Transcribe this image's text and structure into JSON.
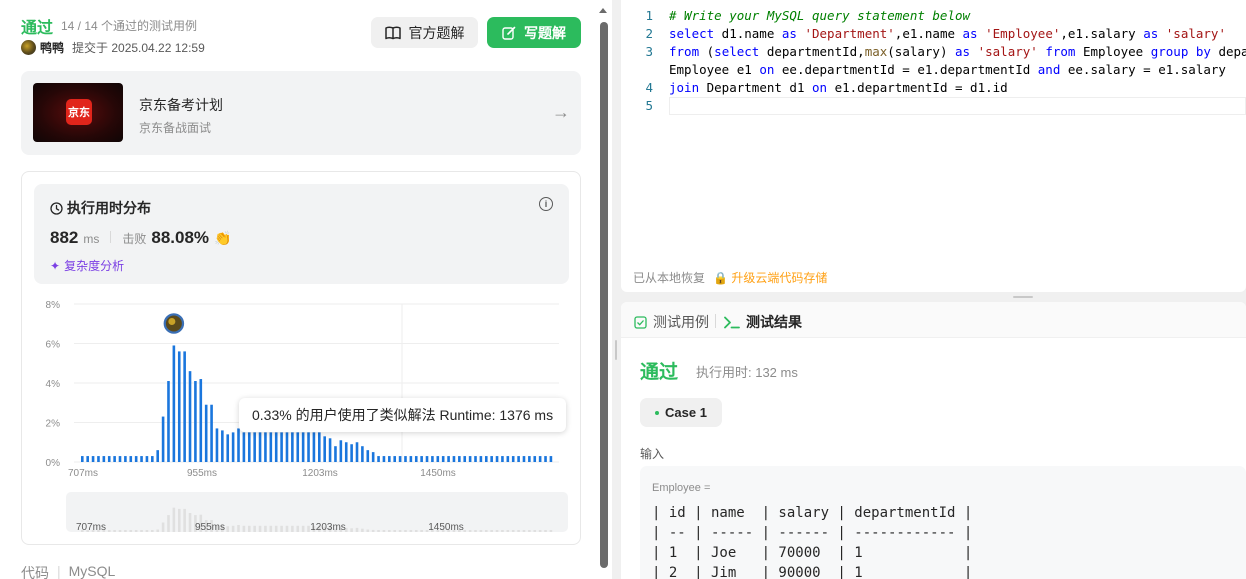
{
  "submission": {
    "status": "通过",
    "testcases": "14 / 14 个通过的测试用例",
    "user": "鸭鸭",
    "submitted_at": "提交于 2025.04.22 12:59",
    "btn_official": "官方题解",
    "btn_write": "写题解"
  },
  "promo": {
    "logo_text": "京东",
    "title": "京东备考计划",
    "subtitle": "京东备战面试"
  },
  "runtime_stats": {
    "title": "执行用时分布",
    "runtime_value": "882",
    "runtime_unit": "ms",
    "beat_label": "击败",
    "beat_value": "88.08%",
    "complexity_link": "复杂度分析",
    "tooltip": "0.33% 的用户使用了类似解法 Runtime: 1376 ms"
  },
  "chart_data": {
    "type": "bar",
    "ylabel": "",
    "xlabel": "",
    "y_ticks": [
      "8%",
      "6%",
      "4%",
      "2%",
      "0%"
    ],
    "ylim": [
      0,
      8
    ],
    "x_ticks": [
      "707ms",
      "955ms",
      "1203ms",
      "1450ms"
    ],
    "series": [
      {
        "values": [
          0.3,
          0.3,
          0.3,
          0.3,
          0.3,
          0.3,
          0.3,
          0.3,
          0.3,
          0.3,
          0.3,
          0.3,
          0.3,
          0.3,
          0.6,
          2.3,
          4.1,
          5.9,
          5.6,
          5.6,
          4.6,
          4.1,
          4.2,
          2.9,
          2.9,
          1.7,
          1.6,
          1.4,
          1.5,
          1.7,
          1.5,
          1.5,
          1.5,
          1.5,
          1.5,
          1.5,
          1.5,
          1.5,
          1.5,
          1.5,
          1.5,
          1.5,
          1.5,
          1.5,
          1.5,
          1.3,
          1.2,
          0.8,
          1.1,
          1.0,
          0.9,
          1.0,
          0.8,
          0.6,
          0.5,
          0.3,
          0.3,
          0.3,
          0.3,
          0.3,
          0.3,
          0.3,
          0.3,
          0.3,
          0.3,
          0.3,
          0.3,
          0.3,
          0.3,
          0.3,
          0.3,
          0.3,
          0.3,
          0.3,
          0.3,
          0.3,
          0.3,
          0.3,
          0.3,
          0.3,
          0.3,
          0.3,
          0.3,
          0.3,
          0.3,
          0.3,
          0.3,
          0.3
        ]
      }
    ],
    "highlight_index": 17,
    "colors": {
      "bar": "#1a76dd",
      "mini_bar": "#e0e0e0",
      "grid": "#eeeeee"
    }
  },
  "code_footer": {
    "label": "代码",
    "language": "MySQL"
  },
  "editor": {
    "lines": [
      {
        "n": "1",
        "html": "<span class=\"cm\"># Write your MySQL query statement below</span>"
      },
      {
        "n": "2",
        "html": "<span class=\"kw\">select</span> d1.name <span class=\"kw\">as</span> <span class=\"str\">'Department'</span>,e1.name <span class=\"kw\">as</span> <span class=\"str\">'Employee'</span>,e1.salary <span class=\"kw\">as</span> <span class=\"str\">'salary'</span>"
      },
      {
        "n": "3",
        "html": "<span class=\"kw\">from</span> (<span class=\"kw\">select</span> departmentId,<span class=\"fn\">max</span>(salary) <span class=\"kw\">as</span> <span class=\"str\">'salary'</span> <span class=\"kw\">from</span> Employee <span class=\"kw\">group</span> <span class=\"kw\">by</span> departmentId) <span class=\"kw\">as</span> ee <span class=\"kw\">join</span>"
      },
      {
        "n": "",
        "html": "Employee e1 <span class=\"kw\">on</span> ee.departmentId = e1.departmentId <span class=\"kw\">and</span> ee.salary = e1.salary"
      },
      {
        "n": "4",
        "html": "<span class=\"kw\">join</span> Department d1 <span class=\"kw\">on</span> e1.departmentId = d1.id"
      },
      {
        "n": "5",
        "html": ""
      }
    ],
    "restore_text": "已从本地恢复",
    "upgrade_text": "升级云端代码存储"
  },
  "result": {
    "tab_cases": "测试用例",
    "tab_result": "测试结果",
    "status": "通过",
    "runtime": "执行用时: 132 ms",
    "case_label": "Case 1",
    "input_label": "输入",
    "input_name": "Employee =",
    "table_lines": [
      "| id | name  | salary | departmentId |",
      "| -- | ----- | ------ | ------------ |",
      "| 1  | Joe   | 70000  | 1            |",
      "| 2  | Jim   | 90000  | 1            |"
    ]
  }
}
